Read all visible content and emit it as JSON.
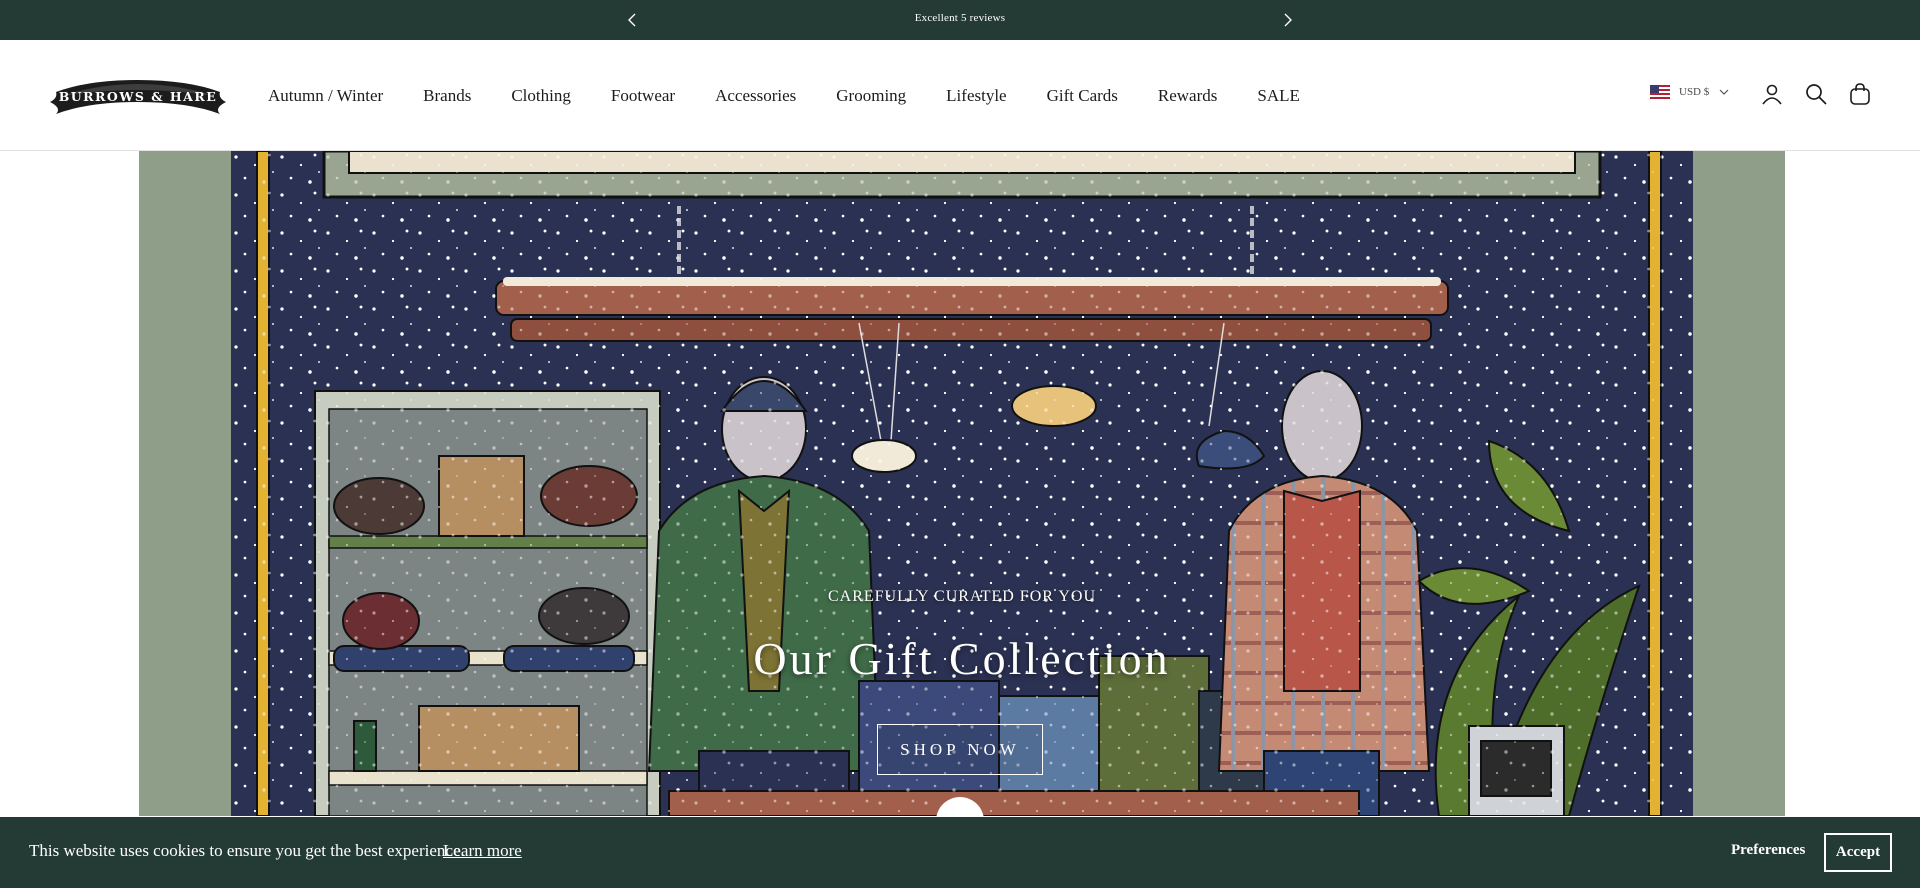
{
  "announcement": {
    "message": "Excellent 5   reviews",
    "prev_icon": "chevron-left-icon",
    "next_icon": "chevron-right-icon"
  },
  "header": {
    "logo_text": "BURROWS & HARE",
    "nav": [
      "Autumn / Winter",
      "Brands",
      "Clothing",
      "Footwear",
      "Accessories",
      "Grooming",
      "Lifestyle",
      "Gift Cards",
      "Rewards",
      "SALE"
    ],
    "currency": {
      "label": "USD $",
      "flag": "us-flag-icon"
    },
    "icons": [
      "account-icon",
      "search-icon",
      "bag-icon"
    ]
  },
  "hero": {
    "subheading": "CAREFULLY CURATED FOR YOU",
    "title": "Our Gift Collection",
    "button": "SHOP NOW"
  },
  "cookie": {
    "text": "This website uses cookies to ensure you get the best experience.",
    "learn_more": "Learn more",
    "preferences": "Preferences",
    "accept": "Accept"
  },
  "colors": {
    "bar_bg": "#233a35",
    "hero_night": "#2b3152",
    "frame_gold": "#e3b232",
    "wall_green": "#8e9e89"
  }
}
